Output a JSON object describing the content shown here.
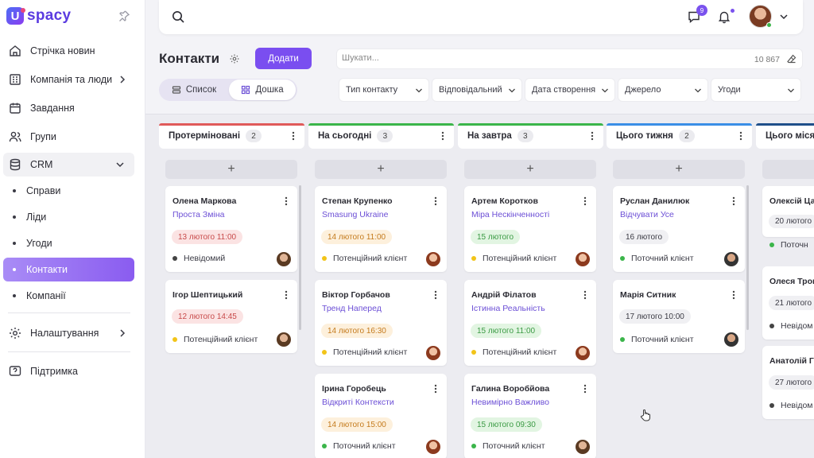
{
  "app": {
    "name": "spacy",
    "logo_letter": "U"
  },
  "sidebar": {
    "items": [
      {
        "label": "Стрічка новин",
        "icon": "home-icon"
      },
      {
        "label": "Компанія та люди",
        "icon": "org-icon"
      },
      {
        "label": "Завдання",
        "icon": "calendar-icon"
      },
      {
        "label": "Групи",
        "icon": "users-icon"
      },
      {
        "label": "CRM",
        "icon": "database-icon"
      }
    ],
    "crm_sub": [
      {
        "label": "Справи"
      },
      {
        "label": "Ліди"
      },
      {
        "label": "Угоди"
      },
      {
        "label": "Контакти",
        "active": true
      },
      {
        "label": "Компанії"
      }
    ],
    "settings": "Налаштування",
    "support": "Підтримка"
  },
  "topbar": {
    "chat_badge": "9"
  },
  "page": {
    "title": "Контакти",
    "add_label": "Додати",
    "view_list": "Список",
    "view_board": "Дошка",
    "search_placeholder": "Шукати...",
    "search_count": "10 867",
    "filters": [
      "Тип контакту",
      "Відповідальний",
      "Дата створення",
      "Джерело",
      "Угоди"
    ]
  },
  "colors": {
    "accent": "#7a4ef0",
    "red": "#e05a5a",
    "green": "#3bb54a",
    "blue": "#3a8ee6",
    "navy": "#1f4f8a"
  },
  "columns": [
    {
      "title": "Протерміновані",
      "count": "2",
      "color": "#e05a5a",
      "cards": [
        {
          "name": "Олена Маркова",
          "company": "Проста Зміна",
          "date": "13 лютого 11:00",
          "date_style": "red",
          "status": "Невідомий",
          "status_color": "grey",
          "avatar": "av1"
        },
        {
          "name": "Ігор Шептицький",
          "company": "",
          "date": "12 лютого 14:45",
          "date_style": "red",
          "status": "Потенційний клієнт",
          "status_color": "yellow",
          "avatar": "av1"
        }
      ]
    },
    {
      "title": "На сьогодні",
      "count": "3",
      "color": "#3bb54a",
      "cards": [
        {
          "name": "Степан Крупенко",
          "company": "Smasung Ukraine",
          "date": "14 лютого 11:00",
          "date_style": "orange",
          "status": "Потенційний клієнт",
          "status_color": "yellow",
          "avatar": "av2"
        },
        {
          "name": "Віктор Горбачов",
          "company": "Тренд Наперед",
          "date": "14 лютого 16:30",
          "date_style": "orange",
          "status": "Потенційний клієнт",
          "status_color": "yellow",
          "avatar": "av2"
        },
        {
          "name": "Ірина Горобець",
          "company": "Відкриті Контексти",
          "date": "14 лютого 15:00",
          "date_style": "orange",
          "status": "Поточний клієнт",
          "status_color": "green",
          "avatar": "av2"
        }
      ]
    },
    {
      "title": "На завтра",
      "count": "3",
      "color": "#3bb54a",
      "cards": [
        {
          "name": "Артем Коротков",
          "company": "Міра Нескінченності",
          "date": "15 лютого",
          "date_style": "green",
          "status": "Потенційний клієнт",
          "status_color": "yellow",
          "avatar": "av2"
        },
        {
          "name": "Андрій Філатов",
          "company": "Істинна Реальність",
          "date": "15 лютого 11:00",
          "date_style": "green",
          "status": "Потенційний клієнт",
          "status_color": "yellow",
          "avatar": "av2"
        },
        {
          "name": "Галина Воробйова",
          "company": "Невимірно Важливо",
          "date": "15 лютого 09:30",
          "date_style": "green",
          "status": "Поточний клієнт",
          "status_color": "green",
          "avatar": "av1"
        }
      ]
    },
    {
      "title": "Цього тижня",
      "count": "2",
      "color": "#3a8ee6",
      "cards": [
        {
          "name": "Руслан Данилюк",
          "company": "Відчувати Усе",
          "date": "16 лютого",
          "date_style": "grey",
          "status": "Поточний клієнт",
          "status_color": "green",
          "avatar": "av3"
        },
        {
          "name": "Марія Ситник",
          "company": "",
          "date": "17 лютого 10:00",
          "date_style": "grey",
          "status": "Поточний клієнт",
          "status_color": "green",
          "avatar": "av3"
        }
      ]
    },
    {
      "title": "Цього місяц",
      "count": "",
      "color": "#1f4f8a",
      "cards": [
        {
          "name": "Олексій Ца",
          "company": "",
          "date": "20 лютого",
          "date_style": "grey",
          "status": "Поточн",
          "status_color": "green",
          "avatar": ""
        },
        {
          "name": "Олеся Трош",
          "company": "",
          "date": "21 лютого",
          "date_style": "grey",
          "status": "Невідом",
          "status_color": "grey",
          "avatar": ""
        },
        {
          "name": "Анатолій Гр",
          "company": "",
          "date": "27 лютого",
          "date_style": "grey",
          "status": "Невідом",
          "status_color": "grey",
          "avatar": ""
        }
      ]
    }
  ]
}
